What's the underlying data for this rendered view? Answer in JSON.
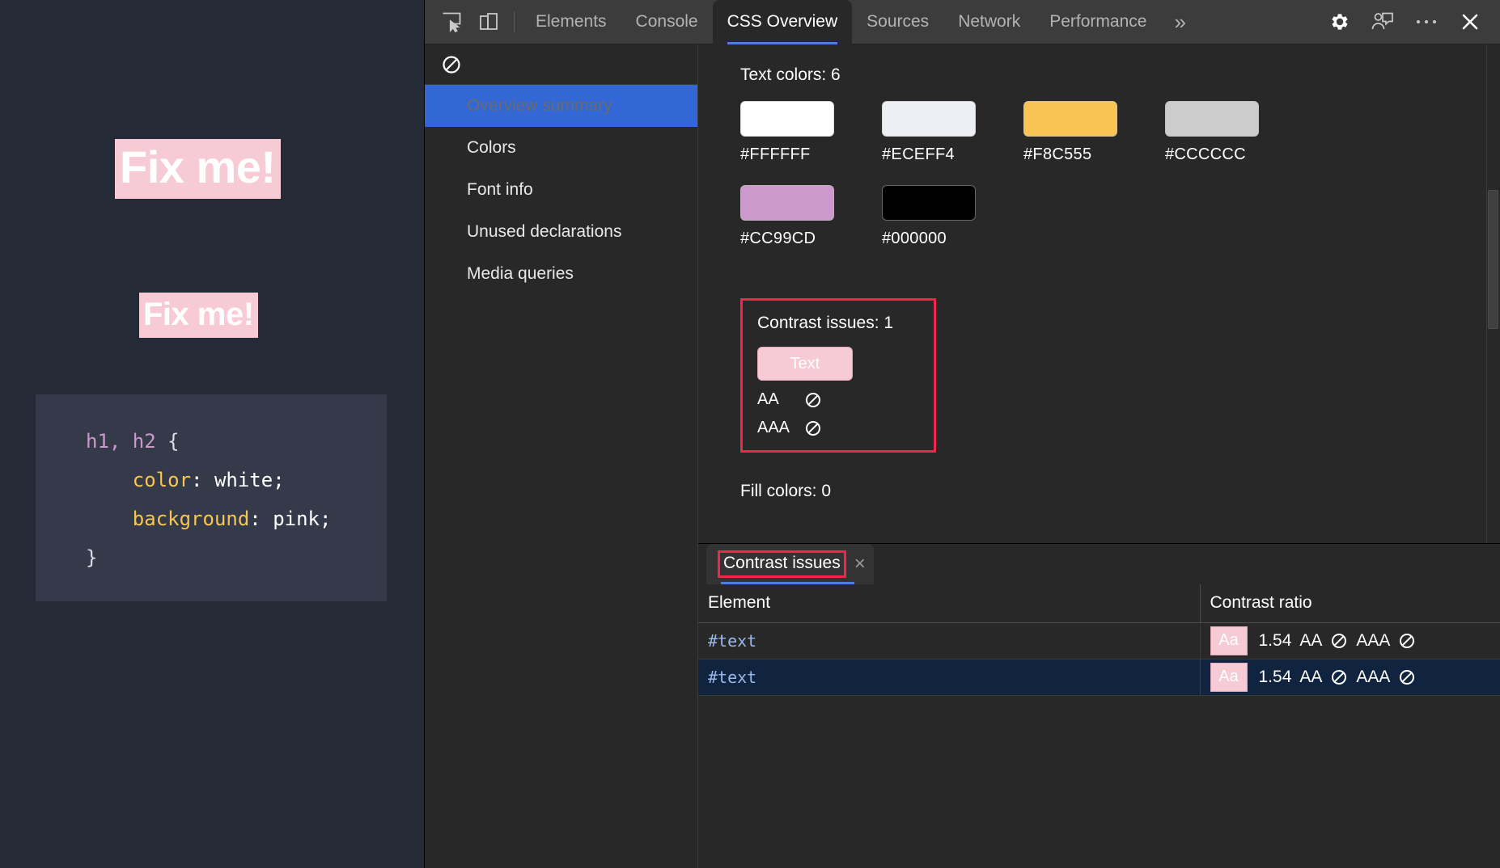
{
  "page": {
    "heading1": "Fix me!",
    "heading2": "Fix me!",
    "code": {
      "line1_sel": "h1, h2",
      "line1_brace": " {",
      "line2_prop": "color",
      "line2_val": ": white;",
      "line3_prop": "background",
      "line3_val": ": pink;",
      "line4": "}"
    }
  },
  "devtools": {
    "toolbar": {
      "inspect_icon": "inspect-element-icon",
      "device_icon": "device-toolbar-icon",
      "tabs": [
        {
          "label": "Elements",
          "active": false
        },
        {
          "label": "Console",
          "active": false
        },
        {
          "label": "CSS Overview",
          "active": true
        },
        {
          "label": "Sources",
          "active": false
        },
        {
          "label": "Network",
          "active": false
        },
        {
          "label": "Performance",
          "active": false
        }
      ],
      "more_tabs": "»",
      "settings_icon": "gear-icon",
      "feedback_icon": "feedback-person-icon",
      "menu_icon": "more-vertical-icon",
      "close_icon": "close-icon"
    },
    "overview_nav": {
      "clear_icon": "clear-overview-icon",
      "items": [
        {
          "label": "Overview summary",
          "selected": true
        },
        {
          "label": "Colors",
          "selected": false
        },
        {
          "label": "Font info",
          "selected": false
        },
        {
          "label": "Unused declarations",
          "selected": false
        },
        {
          "label": "Media queries",
          "selected": false
        }
      ]
    },
    "summary": {
      "text_colors_title": "Text colors: 6",
      "text_colors": [
        {
          "hex": "#FFFFFF"
        },
        {
          "hex": "#ECEFF4"
        },
        {
          "hex": "#F8C555"
        },
        {
          "hex": "#CCCCCC"
        },
        {
          "hex": "#CC99CD"
        },
        {
          "hex": "#000000"
        }
      ],
      "contrast": {
        "title": "Contrast issues: 1",
        "sample_label": "Text",
        "sample_bg": "#F7CBD5",
        "sample_fg": "#FFFFFF",
        "aa_label": "AA",
        "aa_status": "fail-icon",
        "aaa_label": "AAA",
        "aaa_status": "fail-icon",
        "highlight_color": "#F0274A"
      },
      "fill_colors_title": "Fill colors: 0"
    },
    "drawer": {
      "tab_label": "Contrast issues",
      "tab_close": "×",
      "columns": [
        "Element",
        "Contrast ratio"
      ],
      "rows": [
        {
          "element": "#text",
          "chip": "Aa",
          "ratio": "1.54",
          "aa_label": "AA",
          "aa_status": "fail-icon",
          "aaa_label": "AAA",
          "aaa_status": "fail-icon",
          "selected": false
        },
        {
          "element": "#text",
          "chip": "Aa",
          "ratio": "1.54",
          "aa_label": "AA",
          "aa_status": "fail-icon",
          "aaa_label": "AAA",
          "aaa_status": "fail-icon",
          "selected": true
        }
      ]
    }
  }
}
